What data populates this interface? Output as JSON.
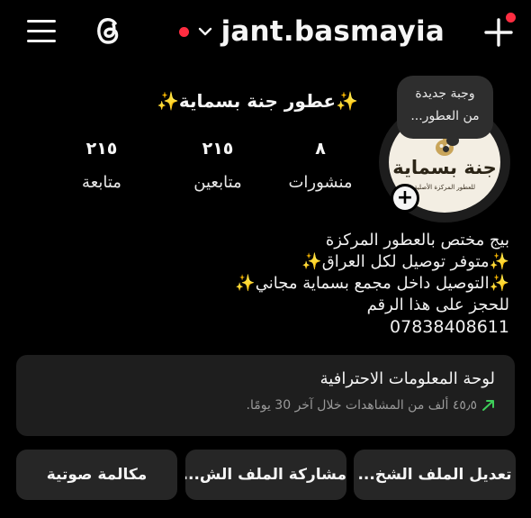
{
  "header": {
    "username": "jant.basmayia",
    "live_dot_color": "#ff2d41",
    "notification_dot_color": "#ff2d41",
    "icons": [
      "menu-icon",
      "threads-icon",
      "chevron-down-icon",
      "plus-icon"
    ]
  },
  "profile": {
    "display_name": "✨عطور جنة بسماية✨",
    "note_line1": "وجبة جديدة",
    "note_line2": "من العطور...",
    "avatar_title": "جنة بسماية",
    "avatar_subtitle": "للعطور المركزة الأصلية",
    "add_badge": "+",
    "stats": [
      {
        "value": "٨",
        "label": "منشورات"
      },
      {
        "value": "٢١٥",
        "label": "متابعين"
      },
      {
        "value": "٢١٥",
        "label": "متابعة"
      }
    ],
    "bio_lines": [
      "بيج مختص بالعطور المركزة",
      "✨متوفر توصيل لكل العراق✨",
      "✨التوصيل داخل مجمع بسماية مجاني✨",
      "للحجز على هذا الرقم",
      "07838408611"
    ]
  },
  "dashboard": {
    "title": "لوحة المعلومات الاحترافية",
    "subtitle": "٤٥٫٥ ألف من المشاهدات خلال آخر 30 يومًا.",
    "trend_color": "#3ecf5a"
  },
  "buttons": {
    "edit_profile": "تعديل الملف الشخ...",
    "share_profile": "مشاركة الملف الش...",
    "voice_call": "مكالمة صوتية"
  }
}
